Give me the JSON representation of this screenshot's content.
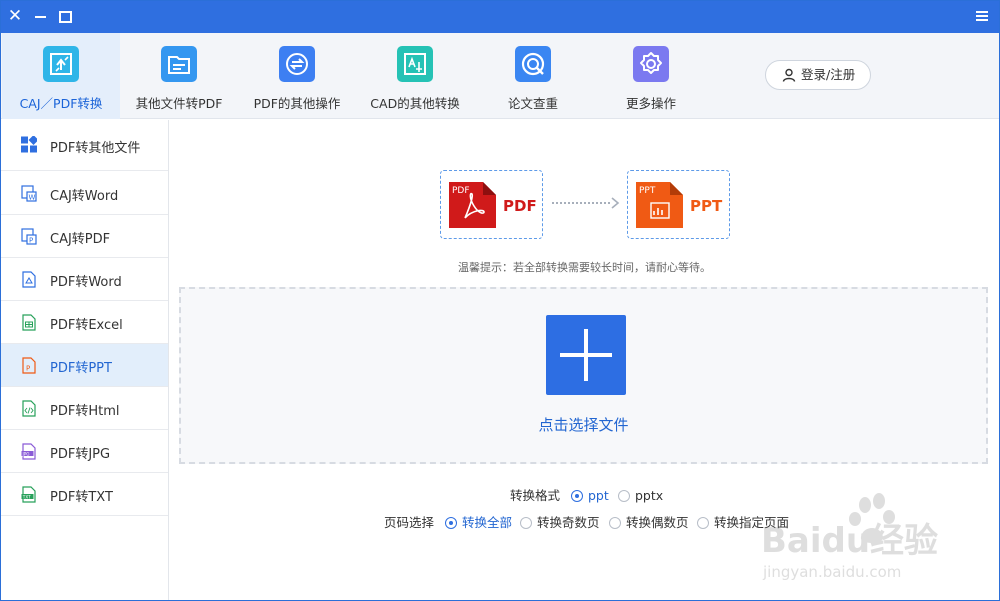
{
  "toolbar": {
    "items": [
      {
        "label": "CAJ／PDF转换",
        "icon": "caj-pdf-convert-icon",
        "color": "#2fb5e8"
      },
      {
        "label": "其他文件转PDF",
        "icon": "folder-icon",
        "color": "#3497f0"
      },
      {
        "label": "PDF的其他操作",
        "icon": "exchange-icon",
        "color": "#3d7ff2"
      },
      {
        "label": "CAD的其他转换",
        "icon": "cad-icon",
        "color": "#25c2b5"
      },
      {
        "label": "论文查重",
        "icon": "search-check-icon",
        "color": "#3a86f2"
      },
      {
        "label": "更多操作",
        "icon": "gear-icon",
        "color": "#7b79f0"
      }
    ],
    "login_label": "登录/注册"
  },
  "sidebar": {
    "items": [
      {
        "label": "PDF转其他文件",
        "icon": "grid-icon"
      },
      {
        "label": "CAJ转Word",
        "icon": "caj-word-icon"
      },
      {
        "label": "CAJ转PDF",
        "icon": "caj-pdf-icon"
      },
      {
        "label": "PDF转Word",
        "icon": "pdf-file-icon"
      },
      {
        "label": "PDF转Excel",
        "icon": "excel-file-icon"
      },
      {
        "label": "PDF转PPT",
        "icon": "ppt-file-icon"
      },
      {
        "label": "PDF转Html",
        "icon": "html-file-icon"
      },
      {
        "label": "PDF转JPG",
        "icon": "jpg-file-icon"
      },
      {
        "label": "PDF转TXT",
        "icon": "txt-file-icon"
      }
    ],
    "active_index": 5
  },
  "main": {
    "from_format": "PDF",
    "from_badge": "PDF",
    "to_format": "PPT",
    "to_badge": "PPT",
    "tip": "温馨提示：若全部转换需要较长时间，请耐心等待。",
    "drop_label": "点击选择文件",
    "format": {
      "label": "转换格式",
      "options": [
        "ppt",
        "pptx"
      ],
      "selected": "ppt"
    },
    "pages": {
      "label": "页码选择",
      "options": [
        "转换全部",
        "转换奇数页",
        "转换偶数页",
        "转换指定页面"
      ],
      "selected": "转换全部"
    }
  },
  "watermark": {
    "brand": "Baidu经验",
    "url": "jingyan.baidu.com"
  },
  "colors": {
    "accent": "#2f6fe0",
    "pdf_red": "#d01a1a",
    "ppt_orange": "#f05a14"
  }
}
